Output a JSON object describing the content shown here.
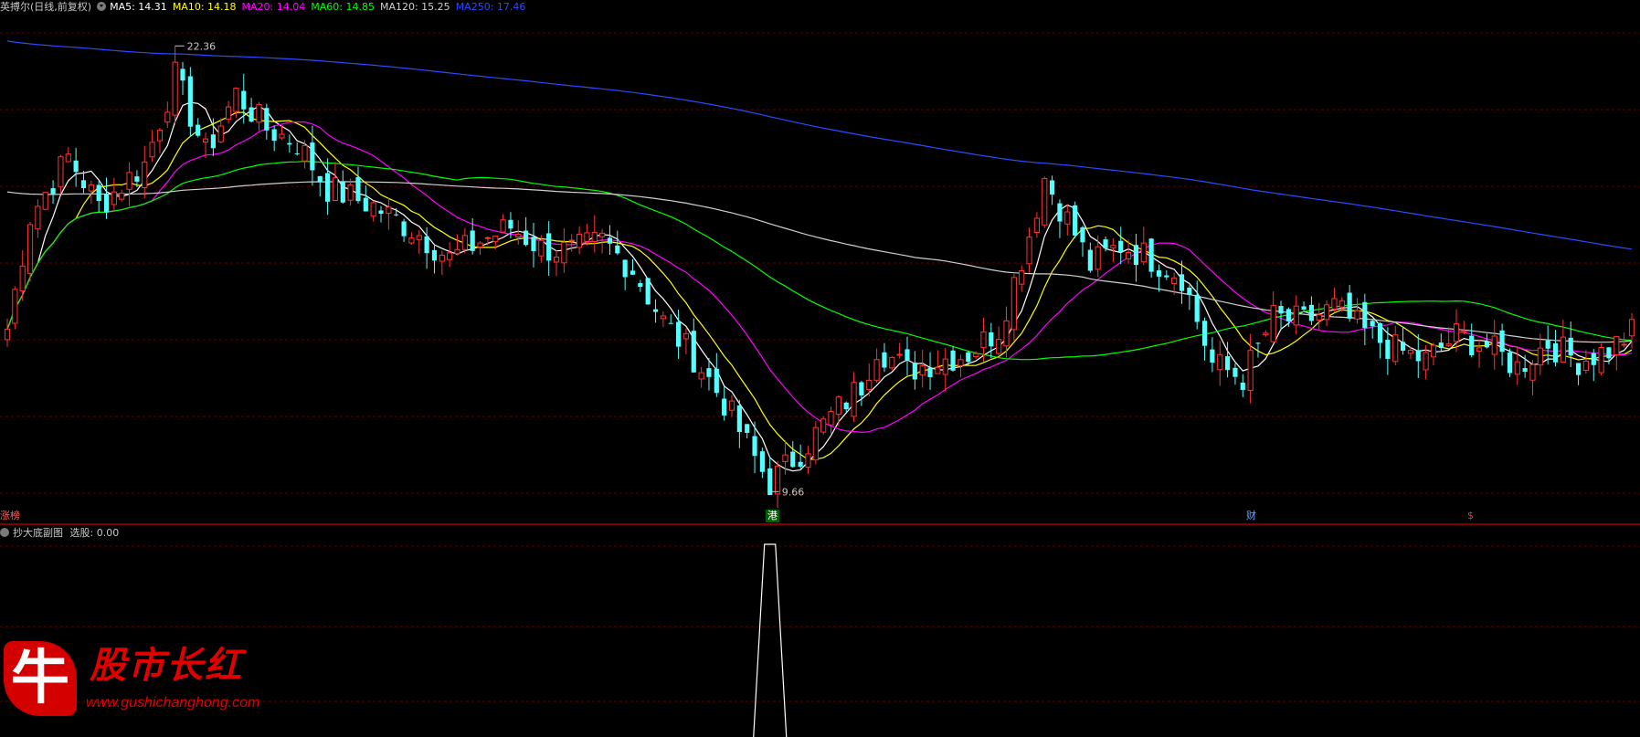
{
  "header": {
    "stock_label": "英搏尔(日线,前复权)",
    "ma_labels": [
      {
        "text": "MA5: 14.31",
        "color": "#ffffff"
      },
      {
        "text": "MA10: 14.18",
        "color": "#ffff00"
      },
      {
        "text": "MA20: 14.04",
        "color": "#ff00ff"
      },
      {
        "text": "MA60: 14.85",
        "color": "#00ff00"
      },
      {
        "text": "MA120: 15.25",
        "color": "#d0d0d0"
      },
      {
        "text": "MA250: 17.46",
        "color": "#2a4bff"
      }
    ]
  },
  "annotations": {
    "high_label": "22.36",
    "low_label": "9.66"
  },
  "bottom_markers": {
    "zt": "涨榜",
    "gang": "港",
    "cai": "财",
    "dollar": "$"
  },
  "sub_panel": {
    "label": "抄大底副图",
    "value_label": "选股: 0.00"
  },
  "logo": {
    "badge": "牛",
    "text": "股市长红",
    "url": "www.gushichanghong.com"
  },
  "colors": {
    "up": "#ff3232",
    "down": "#54ffff",
    "ma5": "#ffffff",
    "ma10": "#ffff00",
    "ma20": "#ff00ff",
    "ma60": "#00ff00",
    "ma120": "#d0d0d0",
    "ma250": "#2a4bff",
    "divider": "#aa0000",
    "grid": "#5a0000"
  },
  "chart_data": {
    "type": "candlestick",
    "price_range": [
      9.2,
      23.2
    ],
    "anchors": [
      [
        0,
        14.3
      ],
      [
        3,
        17.5
      ],
      [
        8,
        19.2
      ],
      [
        12,
        17.8
      ],
      [
        18,
        19.0
      ],
      [
        22,
        21.5
      ],
      [
        26,
        19.3
      ],
      [
        30,
        21.0
      ],
      [
        34,
        20.0
      ],
      [
        38,
        19.6
      ],
      [
        42,
        18.3
      ],
      [
        48,
        17.8
      ],
      [
        54,
        17.0
      ],
      [
        58,
        16.3
      ],
      [
        62,
        16.8
      ],
      [
        66,
        17.2
      ],
      [
        70,
        16.6
      ],
      [
        74,
        16.5
      ],
      [
        78,
        16.8
      ],
      [
        82,
        16.0
      ],
      [
        86,
        14.5
      ],
      [
        90,
        13.5
      ],
      [
        94,
        12.2
      ],
      [
        98,
        10.6
      ],
      [
        100,
        9.9
      ],
      [
        104,
        10.8
      ],
      [
        108,
        11.8
      ],
      [
        112,
        12.7
      ],
      [
        114,
        13.8
      ],
      [
        118,
        13.1
      ],
      [
        122,
        13.4
      ],
      [
        126,
        13.6
      ],
      [
        130,
        14.3
      ],
      [
        134,
        17.0
      ],
      [
        136,
        18.6
      ],
      [
        140,
        17.0
      ],
      [
        142,
        16.1
      ],
      [
        146,
        16.7
      ],
      [
        150,
        16.3
      ],
      [
        154,
        15.8
      ],
      [
        158,
        13.3
      ],
      [
        162,
        12.9
      ],
      [
        166,
        14.6
      ],
      [
        170,
        14.5
      ],
      [
        174,
        14.9
      ],
      [
        178,
        14.2
      ],
      [
        182,
        13.7
      ],
      [
        186,
        13.4
      ],
      [
        190,
        14.1
      ],
      [
        194,
        13.8
      ],
      [
        198,
        13.2
      ],
      [
        202,
        13.9
      ],
      [
        206,
        13.4
      ],
      [
        210,
        13.7
      ],
      [
        213,
        14.2
      ]
    ],
    "high_point": {
      "price": 22.36
    },
    "low_point": {
      "price": 9.66
    },
    "moving_averages": [
      {
        "name": "MA5",
        "period": 5
      },
      {
        "name": "MA10",
        "period": 10
      },
      {
        "name": "MA20",
        "period": 20
      },
      {
        "name": "MA60",
        "period": 60
      },
      {
        "name": "MA120",
        "period": 120
      },
      {
        "name": "MA250",
        "period": 250
      }
    ],
    "sub_signal": {
      "peak_index": 100,
      "peak_value": 1.0,
      "base_value": 0.0
    }
  }
}
